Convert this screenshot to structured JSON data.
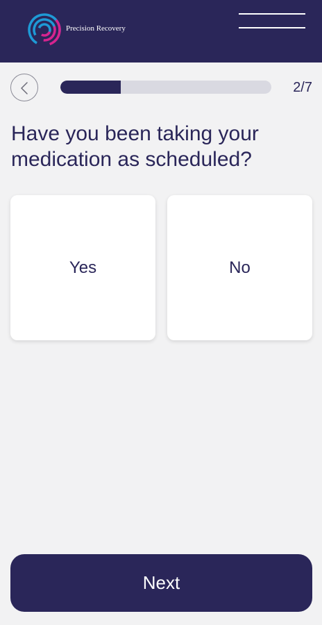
{
  "header": {
    "brand_name": "Precision Recovery",
    "logo_icon": "concentric-arcs-logo",
    "menu_icon": "hamburger-menu-icon",
    "background_color": "#2a2659"
  },
  "progress": {
    "back_icon": "chevron-left-icon",
    "step_label": "2/7",
    "current_step": 2,
    "total_steps": 7,
    "fraction": 0.2857
  },
  "question": {
    "text": "Have you been taking your medication as scheduled?"
  },
  "options": [
    {
      "label": "Yes"
    },
    {
      "label": "No"
    }
  ],
  "footer": {
    "next_label": "Next"
  },
  "colors": {
    "primary": "#2a2659",
    "background": "#f2f2f3",
    "track": "#d9d9e1",
    "logo_blue": "#1e9ad6",
    "logo_magenta": "#d6248f"
  }
}
